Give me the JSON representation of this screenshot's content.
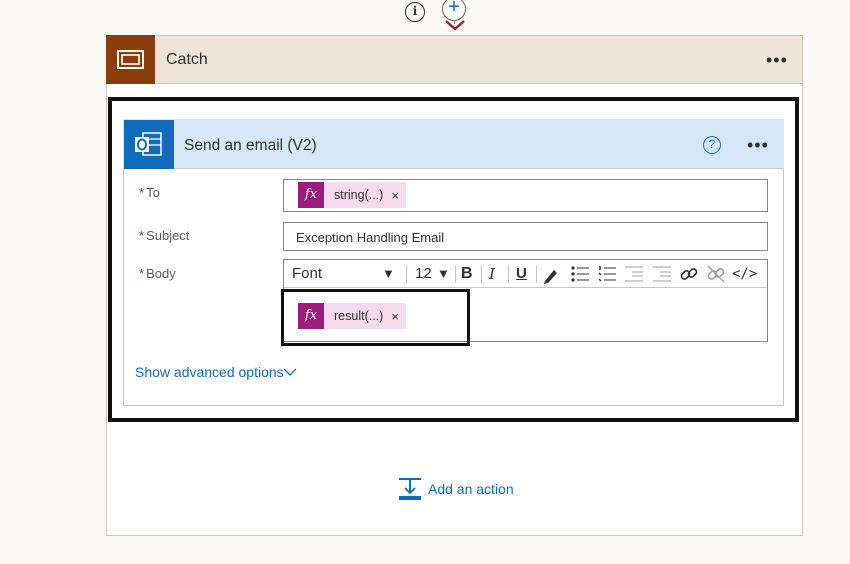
{
  "connector": {
    "info_glyph": "i",
    "plus_glyph": "+"
  },
  "catch": {
    "title": "Catch",
    "more": "•••"
  },
  "email": {
    "title": "Send an email (V2)",
    "help_glyph": "?",
    "more": "•••",
    "to_label": "To",
    "subject_label": "Subject",
    "body_label": "Body",
    "required_mark": "*",
    "to_token": {
      "fx": "fx",
      "label": "string(...)",
      "close": "×"
    },
    "subject_value": "Exception Handling Email",
    "body_token": {
      "fx": "fx",
      "label": "result(...)",
      "close": "×"
    },
    "toolbar": {
      "font": "Font",
      "font_caret": "▼",
      "size": "12",
      "size_caret": "▼",
      "bold": "B",
      "italic": "I",
      "underline": "U",
      "code": "</>"
    },
    "advanced_label": "Show advanced options"
  },
  "add_action_label": "Add an action",
  "colors": {
    "catch_accent": "#8c3d0c",
    "catch_header_bg": "#efe4da",
    "email_header_bg": "#d6e8f7",
    "outlook_blue": "#0f6cbd",
    "token_bg": "#f4dbee",
    "token_fx": "#9b1c7f",
    "link": "#0f6cbd"
  },
  "icons": [
    "info-icon",
    "plus-icon",
    "chevron-down-icon",
    "scope-icon",
    "outlook-icon",
    "help-icon",
    "more-icon",
    "pen-icon",
    "bullet-list-icon",
    "number-list-icon",
    "outdent-icon",
    "indent-icon",
    "link-icon",
    "unlink-icon",
    "code-icon",
    "insert-step-icon"
  ]
}
